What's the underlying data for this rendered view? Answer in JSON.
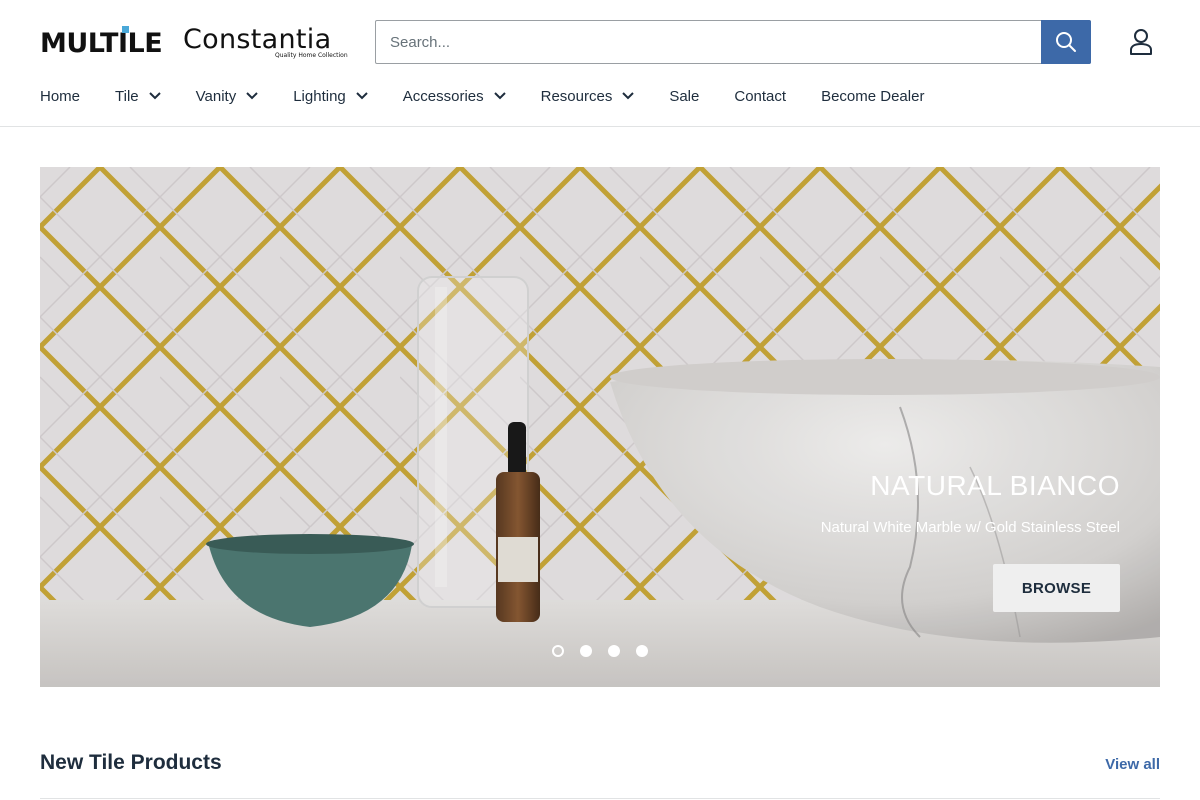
{
  "brand": {
    "logo_primary": "MULTILE",
    "logo_secondary": "Constantia",
    "logo_secondary_tagline": "Quality Home Collection",
    "accent_color": "#3d69a8"
  },
  "search": {
    "placeholder": "Search...",
    "button_icon": "search-icon"
  },
  "account": {
    "icon": "user-icon"
  },
  "nav": {
    "items": [
      {
        "label": "Home",
        "has_dropdown": false
      },
      {
        "label": "Tile",
        "has_dropdown": true
      },
      {
        "label": "Vanity",
        "has_dropdown": true
      },
      {
        "label": "Lighting",
        "has_dropdown": true
      },
      {
        "label": "Accessories",
        "has_dropdown": true
      },
      {
        "label": "Resources",
        "has_dropdown": true
      },
      {
        "label": "Sale",
        "has_dropdown": false
      },
      {
        "label": "Contact",
        "has_dropdown": false
      },
      {
        "label": "Become Dealer",
        "has_dropdown": false
      }
    ]
  },
  "hero": {
    "title": "NATURAL BIANCO",
    "subtitle": "Natural White Marble w/ Gold Stainless Steel",
    "button_label": "BROWSE",
    "slide_count": 4,
    "active_slide": 1
  },
  "section": {
    "title": "New Tile Products",
    "view_all_label": "View all"
  }
}
